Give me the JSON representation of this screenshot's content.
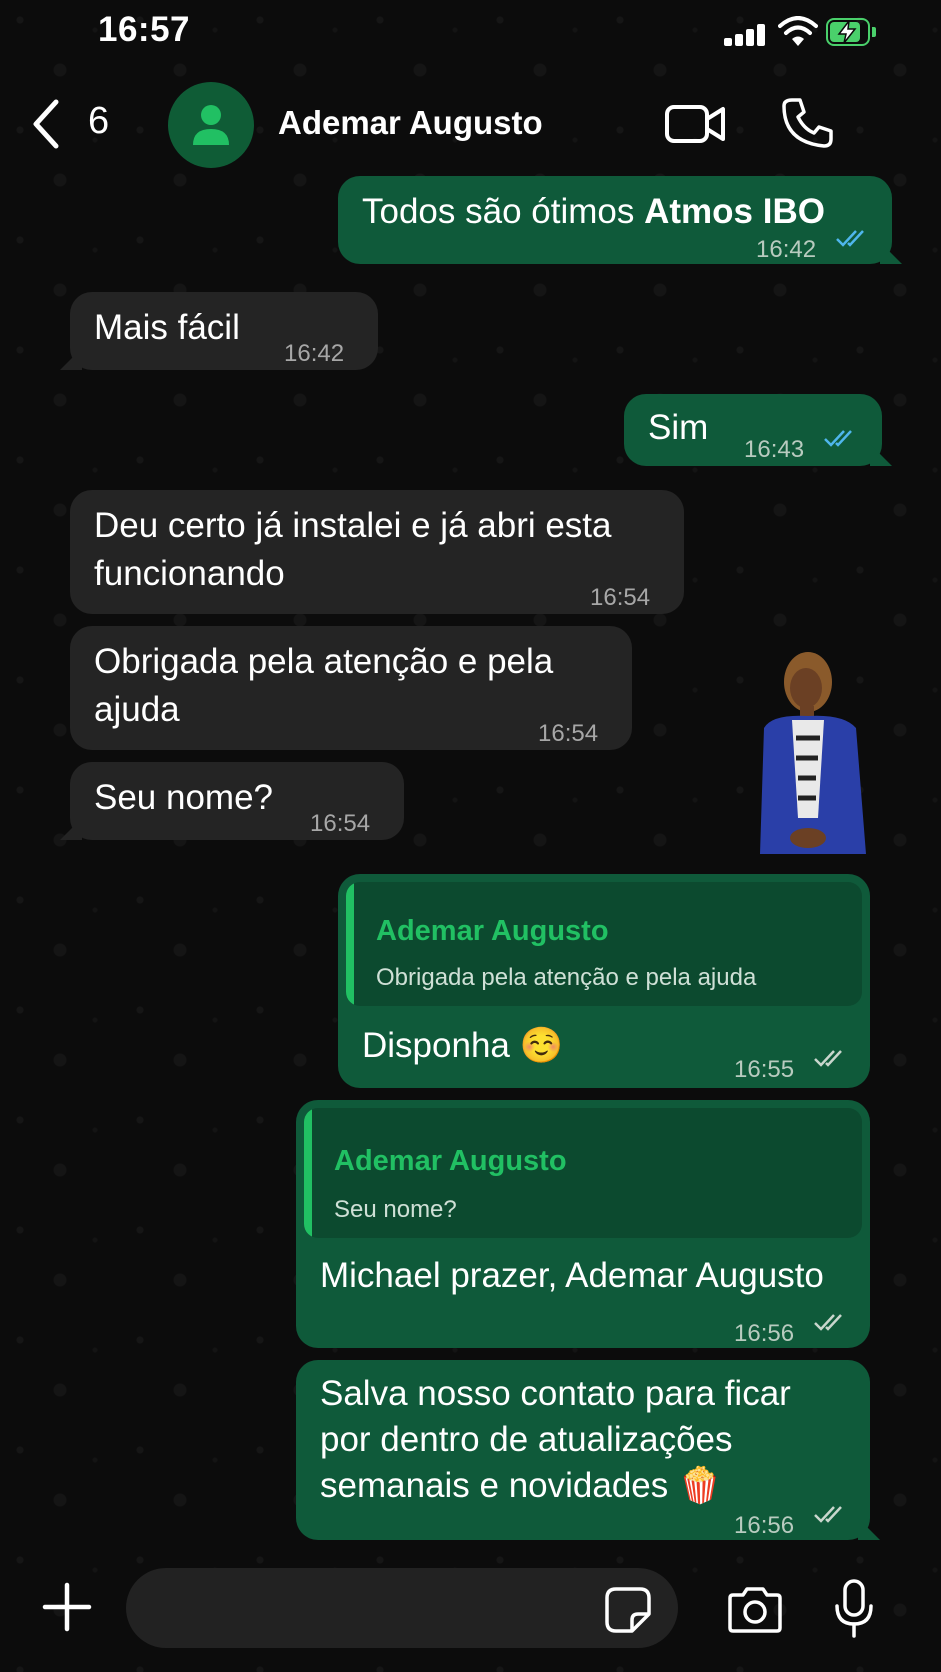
{
  "status_bar": {
    "time": "16:57"
  },
  "header": {
    "back_count": "6",
    "contact_name": "Ademar Augusto",
    "icons": [
      "chevron-left-icon",
      "person-icon",
      "video-icon",
      "phone-icon"
    ]
  },
  "messages": [
    {
      "direction": "out",
      "text_prefix": "Todos são ótimos ",
      "text_bold": "Atmos IBO",
      "time": "16:42",
      "status": "read"
    },
    {
      "direction": "in",
      "text": "Mais fácil",
      "time": "16:42"
    },
    {
      "direction": "out",
      "text": "Sim",
      "time": "16:43",
      "status": "read"
    },
    {
      "direction": "in",
      "line1": "Deu certo já instalei e já abri esta",
      "line2": "funcionando",
      "time": "16:54"
    },
    {
      "direction": "in",
      "line1": "Obrigada pela atenção e pela",
      "line2": "ajuda",
      "time": "16:54"
    },
    {
      "direction": "in",
      "text": "Seu nome?",
      "time": "16:54"
    },
    {
      "direction": "out",
      "quote_name": "Ademar Augusto",
      "quote_text": "Obrigada pela atenção e pela ajuda",
      "text": "Disponha ☺️",
      "time": "16:55",
      "status": "delivered"
    },
    {
      "direction": "out",
      "quote_name": "Ademar Augusto",
      "quote_text": "Seu nome?",
      "text": "Michael prazer, Ademar Augusto",
      "time": "16:56",
      "status": "delivered"
    },
    {
      "direction": "out",
      "line1": "Salva nosso contato para ficar",
      "line2": "por dentro de atualizações",
      "line3": "semanais e novidades 🍿",
      "time": "16:56",
      "status": "delivered"
    }
  ],
  "input_bar": {
    "icons": [
      "plus-icon",
      "sticker-icon",
      "camera-icon",
      "microphone-icon"
    ]
  },
  "colors": {
    "outgoing": "#0f5a3a",
    "incoming": "#242424",
    "accent": "#21c063",
    "read_ticks": "#4fb6ec"
  }
}
